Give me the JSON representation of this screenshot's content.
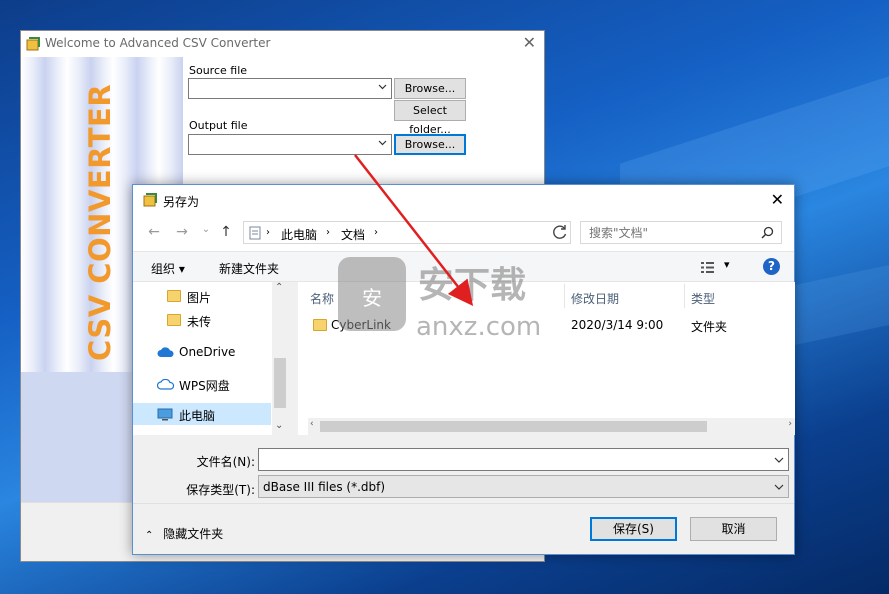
{
  "converter": {
    "title": "Welcome to Advanced CSV Converter",
    "banner": "CSV CONVERTER",
    "source_label": "Source file",
    "source_value": "",
    "browse_label": "Browse...",
    "select_folder_label": "Select folder...",
    "output_label": "Output file",
    "output_value": ""
  },
  "dialog": {
    "title": "另存为",
    "breadcrumb": [
      "此电脑",
      "文档"
    ],
    "search_placeholder": "搜索\"文档\"",
    "toolbar": {
      "organize": "组织 ▾",
      "new_folder": "新建文件夹"
    },
    "nav_items": [
      {
        "label": "图片",
        "icon": "folder-icon"
      },
      {
        "label": "未传",
        "icon": "folder-icon"
      },
      {
        "label": "OneDrive",
        "icon": "cloud-icon"
      },
      {
        "label": "WPS网盘",
        "icon": "cloud-icon"
      },
      {
        "label": "此电脑",
        "icon": "computer-icon",
        "selected": true
      }
    ],
    "columns": [
      "名称",
      "修改日期",
      "类型"
    ],
    "files": [
      {
        "name": "CyberLink",
        "modified": "2020/3/14 9:00",
        "type": "文件夹"
      }
    ],
    "filename_label": "文件名(N):",
    "filename_value": "",
    "filetype_label": "保存类型(T):",
    "filetype_value": "dBase III files (*.dbf)",
    "hide_folders": "隐藏文件夹",
    "save_label": "保存(S)",
    "cancel_label": "取消"
  },
  "watermark": {
    "cn": "安下载",
    "en": "anxz.com"
  },
  "colors": {
    "accent": "#0078d7",
    "banner_text": "#f2992e",
    "arrow": "#e02020"
  }
}
